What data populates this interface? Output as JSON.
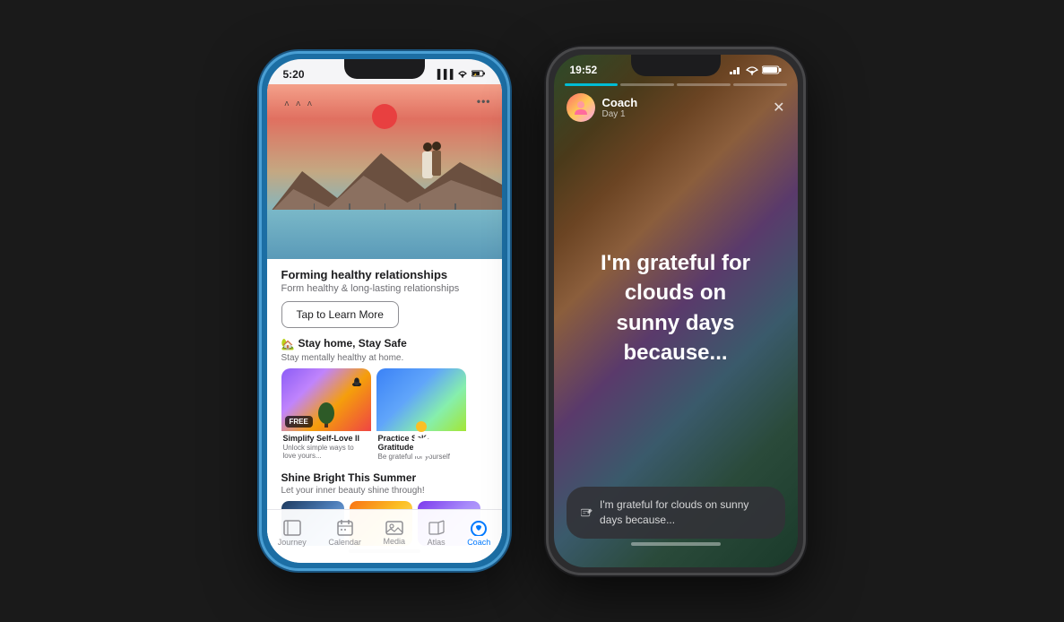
{
  "phone1": {
    "status": {
      "time": "5:20",
      "signal": "▐▐▐",
      "wifi": "WiFi",
      "battery": "⚡"
    },
    "hero": {
      "more_dots": "•••"
    },
    "main_title": "Forming healthy relationships",
    "main_subtitle": "Form healthy & long-lasting relationships",
    "tap_button": "Tap to Learn More",
    "section1_icon": "🏡",
    "section1_title": "Stay home, Stay Safe",
    "section1_subtitle": "Stay mentally healthy at home.",
    "card1_badge": "FREE",
    "card1_title": "Simplify Self-Love II",
    "card1_desc": "Unlock simple ways to love yours...",
    "card2_title": "Practice Self-Gratitude",
    "card2_desc": "Be grateful for yourself",
    "section2_title": "Shine Bright This Summer",
    "section2_subtitle": "Let your inner beauty shine through!",
    "nav": {
      "journey": "Journey",
      "calendar": "Calendar",
      "media": "Media",
      "atlas": "Atlas",
      "coach": "Coach"
    }
  },
  "phone2": {
    "status": {
      "time": "19:52",
      "signal": "▐▐▐",
      "wifi": "WiFi",
      "battery": "🔋"
    },
    "progress_bars": [
      {
        "active": true
      },
      {
        "active": false
      },
      {
        "active": false
      },
      {
        "active": false
      }
    ],
    "coach_name": "Coach",
    "coach_day": "Day 1",
    "close_icon": "✕",
    "main_quote": "I'm grateful for clouds on\nsunny days because...",
    "input_placeholder": "I'm grateful for clouds on sunny days because...",
    "coach_avatar_emoji": "🧑"
  }
}
